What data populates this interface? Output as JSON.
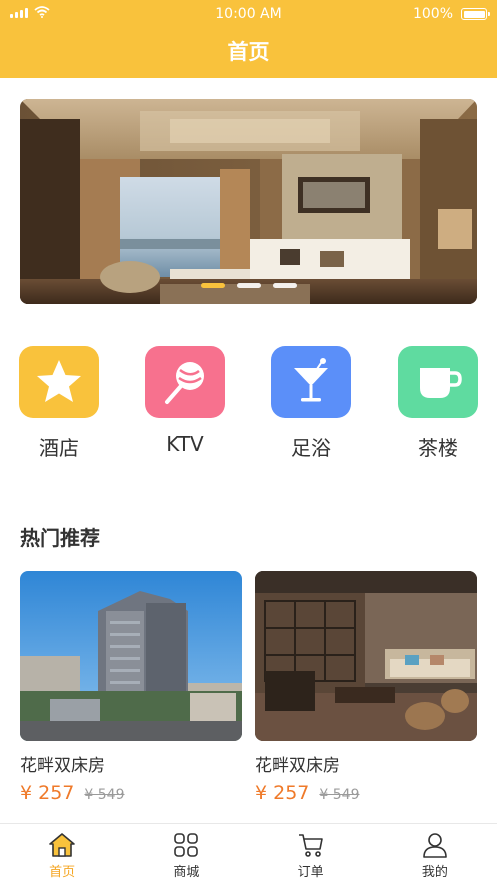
{
  "status_bar": {
    "time": "10:00 AM",
    "battery": "100%",
    "icons": [
      "signal-icon",
      "wifi-icon",
      "battery-icon"
    ]
  },
  "header": {
    "title": "首页",
    "background_color": "#f9c23c"
  },
  "banner": {
    "image": "hotel-room-photo",
    "page_count": 3,
    "active_index": 0
  },
  "categories": [
    {
      "label": "酒店",
      "icon": "star-icon",
      "color": "#f9c23c"
    },
    {
      "label": "KTV",
      "icon": "lollipop-icon",
      "color": "#f7718e"
    },
    {
      "label": "足浴",
      "icon": "cocktail-glass-icon",
      "color": "#5b8ff9"
    },
    {
      "label": "茶楼",
      "icon": "cup-icon",
      "color": "#5fdba0"
    }
  ],
  "section": {
    "title": "热门推荐"
  },
  "products": [
    {
      "name": "花畔双床房",
      "price": "¥ 257",
      "original_price": "¥ 549",
      "image": "hotel-building-photo"
    },
    {
      "name": "花畔双床房",
      "price": "¥ 257",
      "original_price": "¥ 549",
      "image": "tea-room-photo"
    }
  ],
  "tabbar": {
    "items": [
      {
        "label": "首页",
        "icon": "home-icon",
        "active": true
      },
      {
        "label": "商城",
        "icon": "grid-icon",
        "active": false
      },
      {
        "label": "订单",
        "icon": "cart-icon",
        "active": false
      },
      {
        "label": "我的",
        "icon": "user-icon",
        "active": false
      }
    ],
    "accent_color": "#f5a623"
  }
}
